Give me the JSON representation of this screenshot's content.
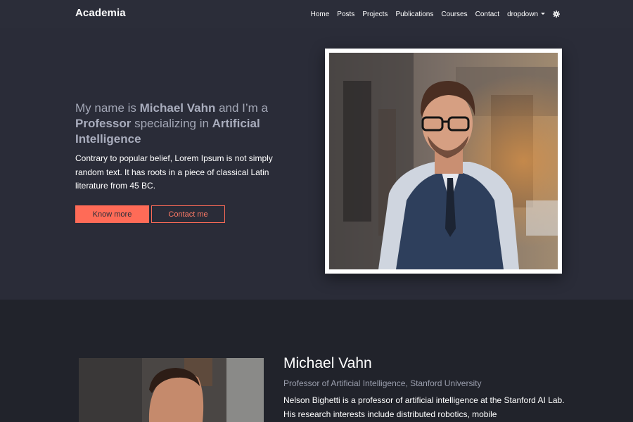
{
  "navbar": {
    "brand": "Academia",
    "links": [
      "Home",
      "Posts",
      "Projects",
      "Publications",
      "Courses",
      "Contact"
    ],
    "dropdown_label": "dropdown",
    "theme_icon": "gear-icon"
  },
  "hero": {
    "title_prefix": "My name is ",
    "name": "Michael Vahn",
    "title_mid": " and I’m a ",
    "role": "Professor",
    "title_mid2": " specializing in ",
    "field": "Artificial Intelligence",
    "description": "Contrary to popular belief, Lorem Ipsum is not simply random text. It has roots in a piece of classical Latin literature from 45 BC.",
    "primary_button": "Know more",
    "secondary_button": "Contact me"
  },
  "about": {
    "name": "Michael Vahn",
    "role": "Professor of Artificial Intelligence, Stanford University",
    "bio": "Nelson Bighetti is a professor of artificial intelligence at the Stanford AI Lab. His research interests include distributed robotics, mobile"
  },
  "colors": {
    "accent": "#ff6b57",
    "navbar_bg": "#2b2d39",
    "hero_bg": "#2a2c38",
    "page_bg": "#21232b"
  }
}
